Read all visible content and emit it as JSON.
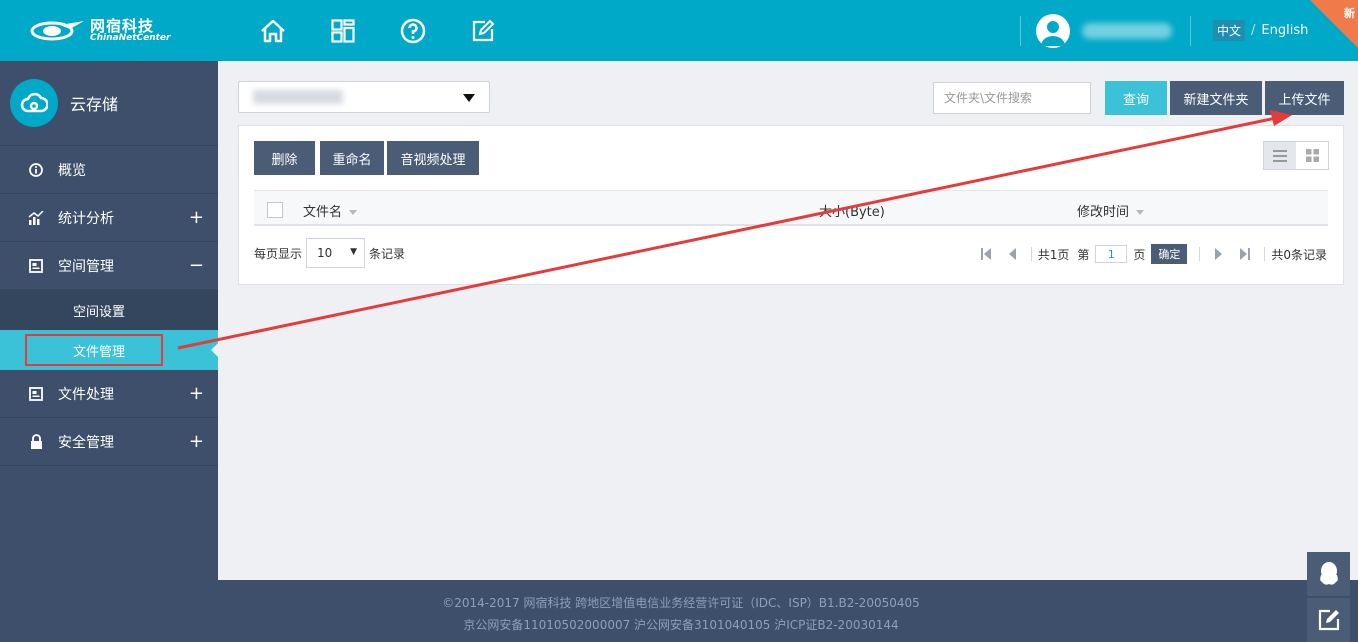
{
  "header": {
    "logo_cn": "网宿科技",
    "logo_en": "ChinaNetCenter",
    "lang_cn": "中文",
    "lang_sep": "/",
    "lang_en": "English",
    "new_badge": "新"
  },
  "sidebar": {
    "brand": "云存储",
    "items": [
      {
        "label": "概览",
        "icon": "info-icon",
        "toggle": ""
      },
      {
        "label": "统计分析",
        "icon": "bar-chart-icon",
        "toggle": "+"
      },
      {
        "label": "空间管理",
        "icon": "window-icon",
        "toggle": "−"
      },
      {
        "label": "文件处理",
        "icon": "window-icon",
        "toggle": "+"
      },
      {
        "label": "安全管理",
        "icon": "lock-icon",
        "toggle": "+"
      }
    ],
    "sub_items": [
      {
        "label": "空间设置"
      },
      {
        "label": "文件管理"
      }
    ]
  },
  "toolbar": {
    "search_placeholder": "文件夹\\文件搜索",
    "query_label": "查询",
    "new_folder_label": "新建文件夹",
    "upload_label": "上传文件"
  },
  "actions": {
    "delete_label": "删除",
    "rename_label": "重命名",
    "av_label": "音视频处理"
  },
  "table": {
    "col_name": "文件名",
    "col_size": "大小(Byte)",
    "col_time": "修改时间"
  },
  "pager": {
    "per_page_prefix": "每页显示",
    "per_page_value": "10",
    "per_page_suffix": "条记录",
    "total_pages": "共1页",
    "page_prefix": "第",
    "current_page": "1",
    "page_suffix": "页",
    "confirm_label": "确定",
    "total_records": "共0条记录"
  },
  "footer": {
    "line1": "©2014-2017 网宿科技 跨地区增值电信业务经营许可证（IDC、ISP）B1.B2-20050405",
    "line2": "京公网安备11010502000007 沪公网安备3101040105 沪ICP证B2-20030144"
  },
  "colors": {
    "accent": "#00a9c8",
    "sidebar": "#3d4f6a",
    "active": "#3bc1d8",
    "button_dark": "#4a5c76",
    "annotation_red": "#e53b3b"
  }
}
